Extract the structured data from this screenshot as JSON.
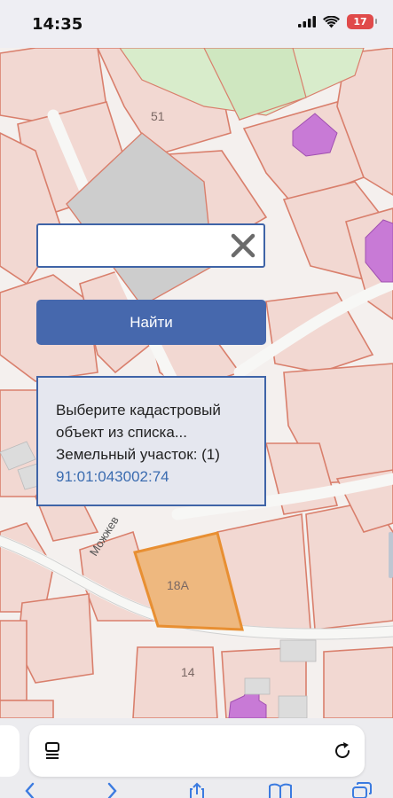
{
  "status_bar": {
    "time": "14:35",
    "battery_level": "17",
    "icons": [
      "cellular-signal-icon",
      "wifi-icon",
      "battery-icon"
    ]
  },
  "map": {
    "labels": {
      "parcel_51": "51",
      "parcel_18a": "18А",
      "parcel_14": "14",
      "street": "Можжев"
    },
    "colors": {
      "parcel_fill": "#f2d8d2",
      "parcel_border": "#d97f6c",
      "green_zone": "#d8eccb",
      "building": "#c87ad6",
      "selected_fill": "#eeb87f",
      "selected_border": "#e88f32",
      "gray_parcel": "#cdcdcd"
    }
  },
  "search": {
    "input_value": "",
    "placeholder": "",
    "find_label": "Найти"
  },
  "result": {
    "line1": "Выберите кадастровый",
    "line2": "объект из списка...",
    "category": "Земельный участок: (1)",
    "cadastral_number": "91:01:043002:74"
  },
  "browser": {
    "icons": [
      "tab-overview-icon",
      "reload-icon",
      "back-icon",
      "forward-icon",
      "share-icon",
      "bookmarks-icon",
      "tabs-icon"
    ]
  },
  "accent_color": "#4668ad"
}
